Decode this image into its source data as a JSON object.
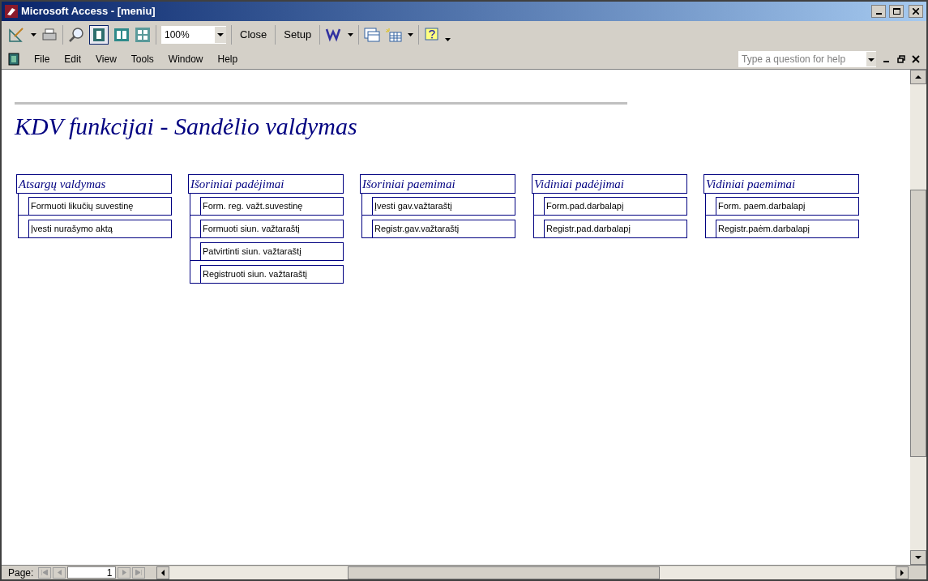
{
  "window": {
    "title": "Microsoft Access - [meniu]"
  },
  "toolbar": {
    "zoom": "100%",
    "buttons": [
      "Close",
      "Setup"
    ]
  },
  "menu": [
    "File",
    "Edit",
    "View",
    "Tools",
    "Window",
    "Help"
  ],
  "help_box": {
    "placeholder": "Type a question for help"
  },
  "report": {
    "title": "KDV funkcijai - Sandėlio valdymas",
    "groups": [
      {
        "header": "Atsargų valdymas",
        "items": [
          "Formuoti likučių suvestinę",
          "Įvesti nurašymo aktą"
        ]
      },
      {
        "header": "Išoriniai padėjimai",
        "items": [
          "Form. reg. važt.suvestinę",
          "Formuoti siun. važtaraštį",
          "Patvirtinti siun. važtaraštį",
          "Registruoti siun. važtaraštį"
        ]
      },
      {
        "header": "Išoriniai paemimai",
        "items": [
          "Įvesti gav.važtaraštį",
          "Registr.gav.važtaraštį"
        ]
      },
      {
        "header": "Vidiniai padėjimai",
        "items": [
          "Form.pad.darbalapį",
          "Registr.pad.darbalapį"
        ]
      },
      {
        "header": "Vidiniai paemimai",
        "items": [
          "Form. paem.darbalapį",
          "Registr.paėm.darbalapį"
        ]
      }
    ]
  },
  "status": {
    "page_label": "Page:",
    "page_number": "1"
  }
}
